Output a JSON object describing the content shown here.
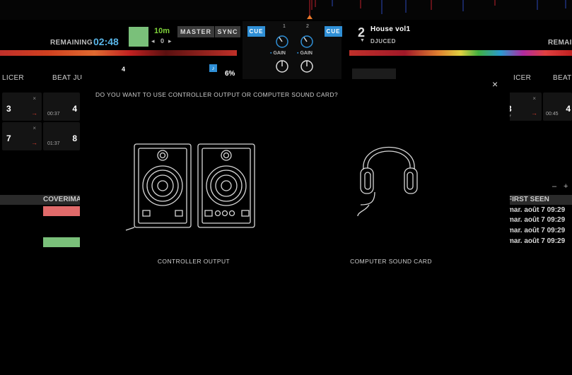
{
  "deck1": {
    "remaining_label": "REMAINING",
    "time": "02:48",
    "bpm_duration": "10m",
    "pitch": "0",
    "master_label": "MASTER",
    "sync_label": "SYNC",
    "beat_number": "4",
    "percent": "6%"
  },
  "mixer": {
    "cue_label": "CUE",
    "channel_1": "1",
    "channel_2": "2",
    "gain_label": "GAIN"
  },
  "deck2": {
    "deck_number": "2",
    "track_title": "House vol1",
    "artist": "DJUCED",
    "remaining_label": "REMAIN",
    "cue_label": "CUE"
  },
  "tabs": {
    "left_slicer": "LICER",
    "left_beat_jump": "BEAT JU",
    "right_slicer": "ICER",
    "right_beat": "BEAT"
  },
  "pads_left": [
    {
      "number": "3",
      "time": "00:37"
    },
    {
      "number": "4",
      "time": ""
    },
    {
      "number": "7",
      "time": ""
    },
    {
      "number": "8",
      "time": "01:37"
    }
  ],
  "pads_right": [
    {
      "number": "3",
      "time": ""
    },
    {
      "number": "4",
      "time": "00:45"
    },
    {
      "number": "7",
      "time": ""
    }
  ],
  "library": {
    "cover_header": "COVERIMA",
    "first_seen_header": "FIRST SEEN",
    "dates": [
      "mar. août 7 09:29",
      "mar. août 7 09:29",
      "mar. août 7 09:29",
      "mar. août 7 09:29"
    ],
    "minus": "–",
    "plus": "+"
  },
  "dialog": {
    "question": "DO YOU WANT TO USE CONTROLLER OUTPUT OR COMPUTER SOUND CARD?",
    "close": "×",
    "option_controller": "CONTROLLER OUTPUT",
    "option_soundcard": "COMPUTER SOUND CARD"
  },
  "colors": {
    "accent_blue": "#2f8fd6",
    "time_blue": "#58b4e6",
    "cover_red": "#e06a6a",
    "cover_green": "#7ac07a"
  }
}
